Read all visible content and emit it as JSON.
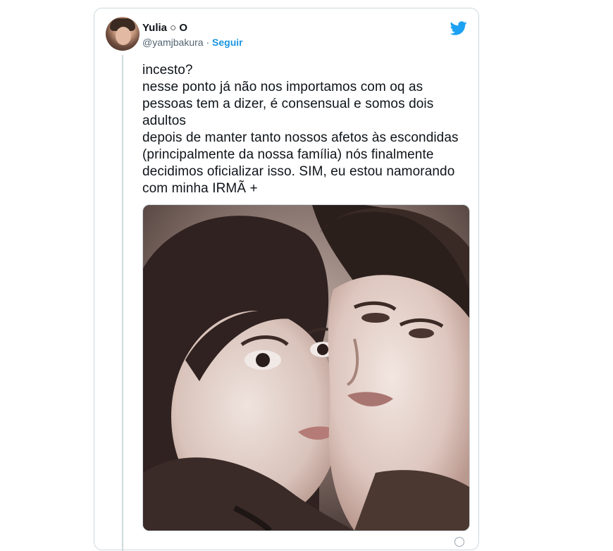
{
  "tweet": {
    "author": {
      "name": "Yulia ○ O",
      "handle": "@yamjbakura",
      "separator": "·",
      "follow_label": "Seguir"
    },
    "text": "incesto?\nnesse ponto já não nos importamos com oq as pessoas tem a dizer, é consensual e somos dois adultos\ndepois de manter tanto nossos afetos às escondidas (principalmente da nossa família) nós finalmente decidimos oficializar isso. SIM, eu estou namorando com minha IRMÃ +",
    "media": {
      "description_icon": "photo-of-two-people"
    }
  },
  "colors": {
    "accent": "#1b95e0",
    "twitter_blue": "#1da1f2",
    "text": "#0f1419",
    "muted": "#536471",
    "border": "#cfd9de"
  },
  "icons": {
    "brand": "twitter-bird-icon"
  }
}
